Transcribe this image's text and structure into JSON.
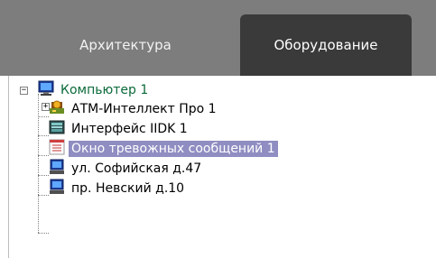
{
  "tabs": [
    {
      "label": "Архитектура",
      "active": false
    },
    {
      "label": "Оборудование",
      "active": true
    }
  ],
  "tree": {
    "root": {
      "label": "Компьютер 1",
      "expanded": true,
      "icon": "computer-icon"
    },
    "children": [
      {
        "label": "АТМ-Интеллект Про 1",
        "icon": "atm-intellect-icon",
        "expandable": true,
        "expanded": false
      },
      {
        "label": "Интерфейс IIDK 1",
        "icon": "iidk-interface-icon",
        "expandable": false
      },
      {
        "label": "Окно тревожных сообщений 1",
        "icon": "alarm-window-icon",
        "expandable": false,
        "selected": true
      },
      {
        "label": "ул. Софийская д.47",
        "icon": "computer-icon",
        "expandable": false
      },
      {
        "label": "пр. Невский д.10",
        "icon": "computer-icon",
        "expandable": false
      }
    ]
  },
  "colors": {
    "tabbar_bg": "#7d7d7d",
    "active_tab_bg": "#3a3a3a",
    "selection_bg": "#8f8dc1",
    "root_label": "#0b6a3a"
  }
}
